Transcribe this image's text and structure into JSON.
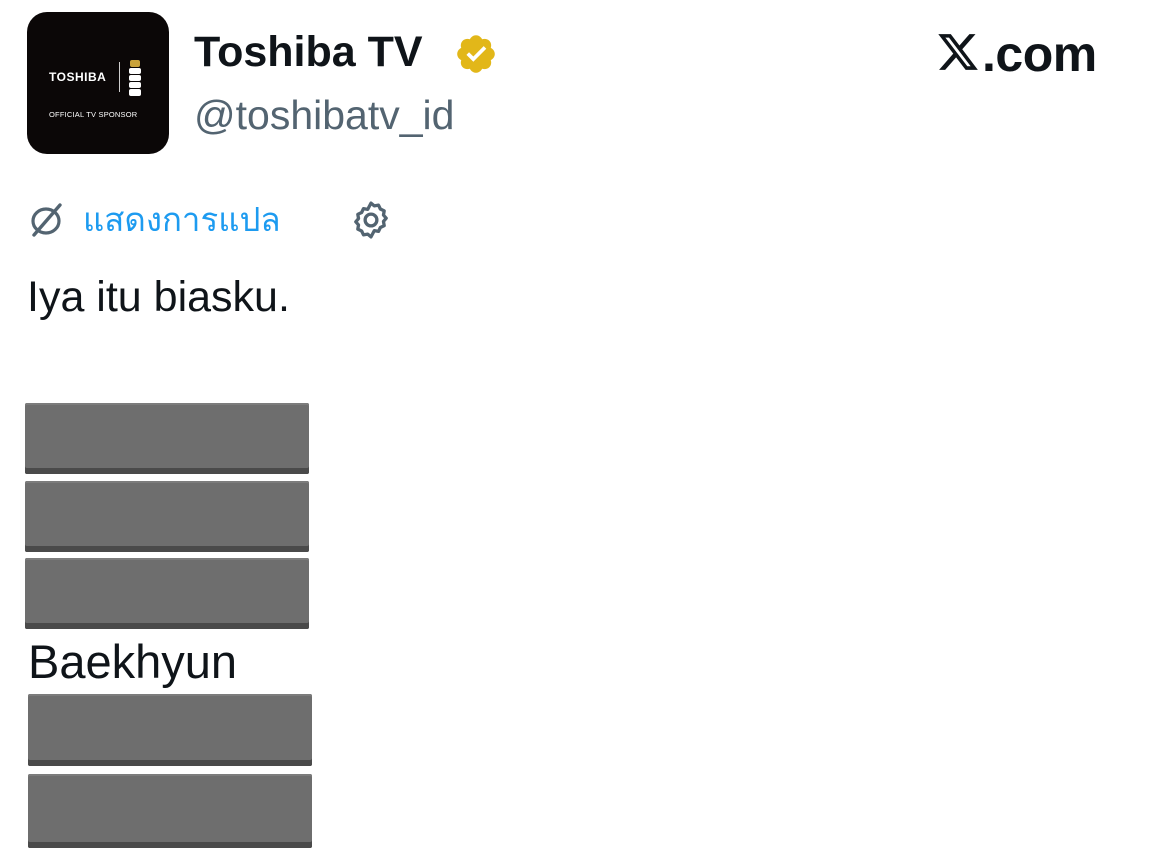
{
  "header": {
    "avatar": {
      "brand_text": "TOSHIBA",
      "sponsor_text": "OFFICIAL TV SPONSOR"
    },
    "display_name": "Toshiba TV",
    "handle": "@toshibatv_id",
    "verified_icon": "verified-badge-icon",
    "site_label": ".com",
    "site_logo_icon": "x-logo-icon"
  },
  "translate": {
    "label": "แสดงการแปล",
    "icon": "translate-icon",
    "settings_icon": "gear-icon"
  },
  "tweet": {
    "text": "Iya itu biasku.",
    "name": "Baekhyun"
  },
  "colors": {
    "text": "#0f1419",
    "secondary": "#536471",
    "link": "#1d9bf0",
    "verified_gold": "#e2b719",
    "redaction": "#6e6e6e"
  }
}
